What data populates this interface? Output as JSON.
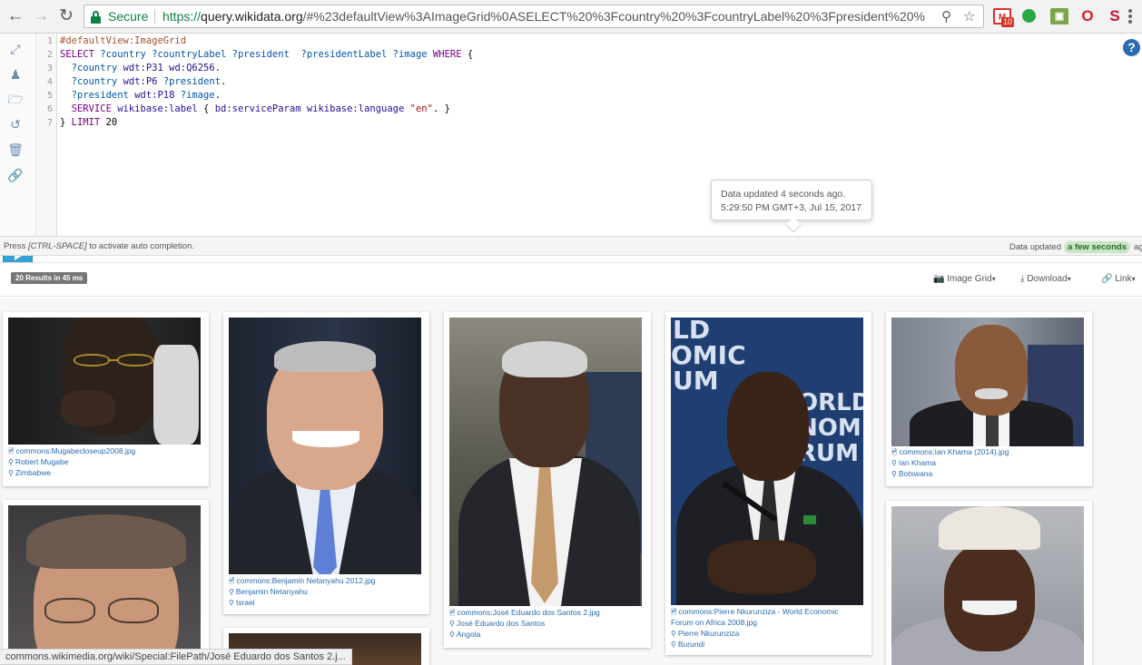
{
  "browser": {
    "secure_label": "Secure",
    "url_scheme": "https://",
    "url_host": "query.wikidata.org",
    "url_rest": "/#%23defaultView%3AImageGrid%0ASELECT%20%3Fcountry%20%3FcountryLabel%20%3Fpresident%20%",
    "gmail_count": "10"
  },
  "editor": {
    "lines": [
      "1",
      "2",
      "3",
      "4",
      "5",
      "6",
      "7"
    ],
    "code": {
      "l1": "#defaultView:ImageGrid",
      "l2_kw": "SELECT",
      "l2_vars": " ?country ?countryLabel ?president  ?presidentLabel ?image ",
      "l2_kw2": "WHERE",
      "l2_end": " {",
      "l3_var": "  ?country ",
      "l3_rest": "wdt:P31 wd:Q6256.",
      "l4_var": "  ?country ",
      "l4_pre": "wdt:P6 ",
      "l4_var2": "?president",
      "l4_end": ".",
      "l5_var": "  ?president ",
      "l5_pre": "wdt:P18 ",
      "l5_var2": "?image",
      "l5_end": ".",
      "l6_kw": "  SERVICE ",
      "l6_pre": "wikibase:label ",
      "l6_mid": "{ ",
      "l6_pre2": "bd:serviceParam wikibase:language ",
      "l6_str": "\"en\"",
      "l6_end": ". }",
      "l7_plain": "} ",
      "l7_kw": "LIMIT",
      "l7_num": " 20"
    },
    "help_label": "?"
  },
  "tooltip": {
    "line1": "Data updated 4 seconds ago.",
    "line2": "5:29:50 PM GMT+3, Jul 15, 2017"
  },
  "status": {
    "hint_prefix": "Press ",
    "hint_key": "[CTRL-SPACE]",
    "hint_suffix": " to activate auto completion.",
    "updated_label": "Data updated",
    "updated_badge": "a few seconds",
    "updated_tail": "ag"
  },
  "results": {
    "count": "20 Results in 45 ms",
    "view_label": "Image Grid",
    "download_label": "Download",
    "link_label": "Link"
  },
  "cards": [
    {
      "file": "commons:Mugabecloseup2008.jpg",
      "president": "Robert Mugabe",
      "country": "Zimbabwe"
    },
    {
      "file": "commons:Benjamin Netanyahu 2012.jpg",
      "president": "Benjamin Netanyahu",
      "country": "Israel"
    },
    {
      "file": "commons:José Eduardo dos Santos 2.jpg",
      "president": "José Eduardo dos Santos",
      "country": "Angola"
    },
    {
      "file": "commons:Pierre Nkurunziza - World Economic",
      "file2": "Forum on Africa 2008.jpg",
      "president": "Pierre Nkurunziza",
      "country": "Burundi"
    },
    {
      "file": "commons:Ian Khama (2014).jpg",
      "president": "Ian Khama",
      "country": "Botswana"
    }
  ],
  "photo_text": {
    "wef_line1": "LD",
    "wef_line2": "OMIC",
    "wef_line3": "UM",
    "wef_line4": "ORLD",
    "wef_line5": "NOMI",
    "wef_line6": "RUM"
  },
  "status_url": "commons.wikimedia.org/wiki/Special:FilePath/José Eduardo dos Santos 2.j..."
}
